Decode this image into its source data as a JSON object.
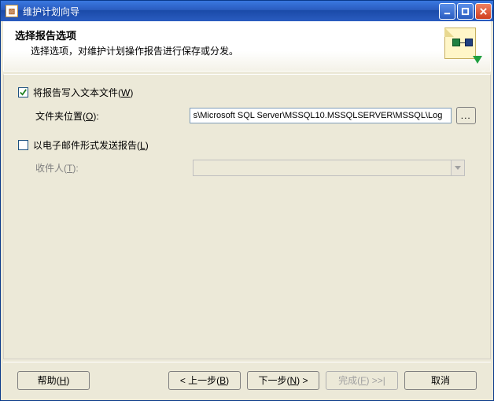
{
  "window": {
    "title": "维护计划向导"
  },
  "header": {
    "title": "选择报告选项",
    "subtitle": "选择选项，对维护计划操作报告进行保存或分发。"
  },
  "options": {
    "writeToFile": {
      "label_pre": "将报告写入文本文件(",
      "accel": "W",
      "label_post": ")",
      "checked": true,
      "folder_label_pre": "文件夹位置(",
      "folder_accel": "O",
      "folder_label_post": "):",
      "folder_value": "s\\Microsoft SQL Server\\MSSQL10.MSSQLSERVER\\MSSQL\\Log",
      "browse": "..."
    },
    "emailReport": {
      "label_pre": "以电子邮件形式发送报告(",
      "accel": "L",
      "label_post": ")",
      "checked": false,
      "recipient_label_pre": "收件人(",
      "recipient_accel": "T",
      "recipient_label_post": "):"
    }
  },
  "footer": {
    "help_pre": "帮助(",
    "help_accel": "H",
    "help_post": ")",
    "back_pre": "< 上一步(",
    "back_accel": "B",
    "back_post": ")",
    "next_pre": "下一步(",
    "next_accel": "N",
    "next_post": ") >",
    "finish_pre": "完成(",
    "finish_accel": "F",
    "finish_post": ") >>|",
    "cancel": "取消"
  }
}
